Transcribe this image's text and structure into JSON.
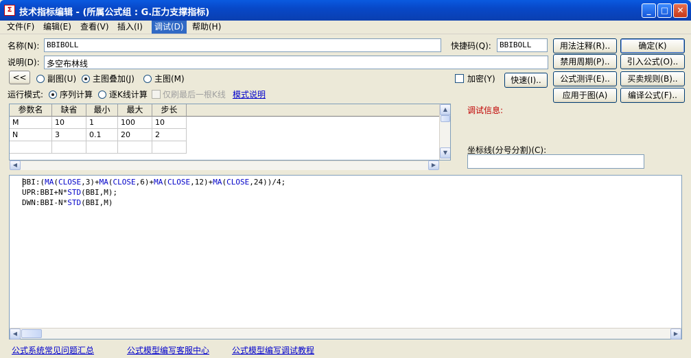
{
  "window": {
    "title": "技术指标编辑 - (所属公式组 : G.压力支撑指标)",
    "icon": "app-formula-icon",
    "controls": {
      "minimize": "_",
      "maximize": "□",
      "close": "✕"
    }
  },
  "menu": [
    {
      "label": "文件(F)"
    },
    {
      "label": "编辑(E)"
    },
    {
      "label": "查看(V)"
    },
    {
      "label": "插入(I)"
    },
    {
      "label": "调试(D)",
      "active": true
    },
    {
      "label": "帮助(H)"
    }
  ],
  "form": {
    "name_label": "名称(N):",
    "name_value": "BBIBOLL",
    "hotkey_label": "快捷码(Q):",
    "hotkey_value": "BBIBOLL",
    "desc_label": "说明(D):",
    "desc_value": "多空布林线",
    "collapse_btn": "<<",
    "display_options": [
      {
        "label": "副图(U)",
        "checked": false
      },
      {
        "label": "主图叠加(J)",
        "checked": true
      },
      {
        "label": "主图(M)",
        "checked": false
      }
    ],
    "encrypt_label": "加密(Y)",
    "encrypt_checked": false,
    "quick_btn": "快速(I)..",
    "run_mode_label": "运行模式:",
    "run_modes": [
      {
        "label": "序列计算",
        "checked": true
      },
      {
        "label": "逐K线计算",
        "checked": false
      }
    ],
    "last_bar_label": "仅刷最后一根K线",
    "mode_link": "模式说明"
  },
  "right_buttons": [
    {
      "label": "用法注释(R)..",
      "name": "usage-notes-button"
    },
    {
      "label": "确定(K)",
      "name": "ok-button",
      "default": true
    },
    {
      "label": "禁用周期(P)..",
      "name": "disable-period-button"
    },
    {
      "label": "引入公式(O)..",
      "name": "import-formula-button"
    },
    {
      "label": "公式测评(E)..",
      "name": "formula-evaluate-button"
    },
    {
      "label": "买卖规则(B)..",
      "name": "trade-rules-button"
    },
    {
      "label": "应用于图(A)",
      "name": "apply-to-chart-button"
    },
    {
      "label": "编译公式(F)..",
      "name": "compile-formula-button"
    }
  ],
  "params": {
    "headers": [
      "参数名",
      "缺省",
      "最小",
      "最大",
      "步长"
    ],
    "rows": [
      [
        "M",
        "10",
        "1",
        "100",
        "10"
      ],
      [
        "N",
        "3",
        "0.1",
        "20",
        "2"
      ]
    ]
  },
  "debug": {
    "info_label": "调试信息:",
    "axis_label": "坐标线(分号分割)(C):",
    "axis_value": ""
  },
  "code_lines": [
    "BBI:(MA(CLOSE,3)+MA(CLOSE,6)+MA(CLOSE,12)+MA(CLOSE,24))/4;",
    "UPR:BBI+N*STD(BBI,M);",
    "DWN:BBI-N*STD(BBI,M)"
  ],
  "footer_links": [
    {
      "label": "公式系统常见问题汇总"
    },
    {
      "label": "公式模型编写客服中心"
    },
    {
      "label": "公式模型编写调试教程"
    }
  ]
}
